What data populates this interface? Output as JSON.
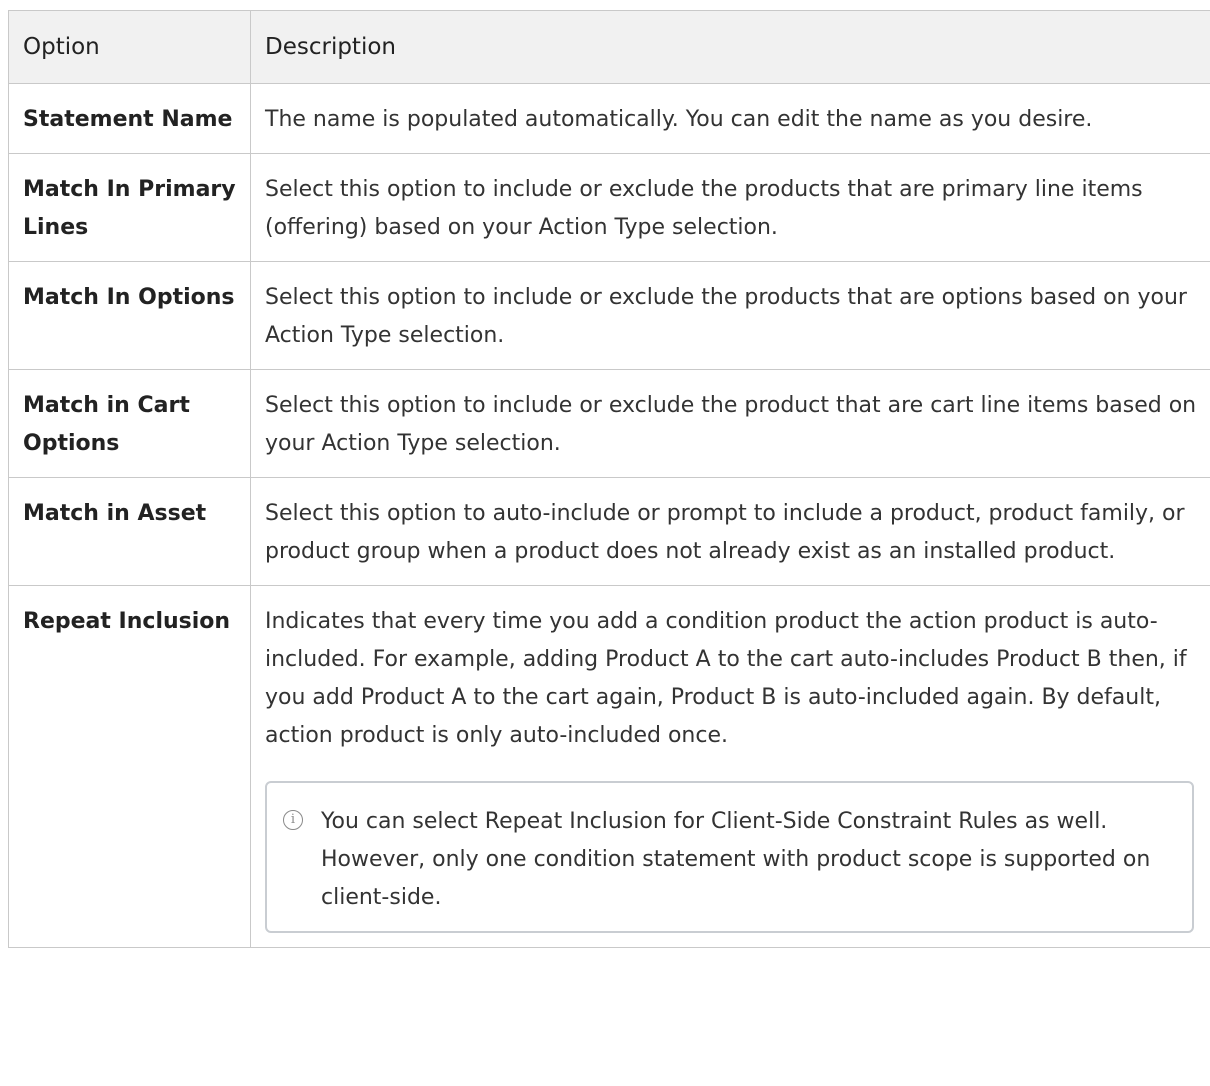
{
  "table": {
    "headers": {
      "option": "Option",
      "description": "Description"
    },
    "rows": [
      {
        "option": "Statement Name",
        "description": "The name is populated automatically. You can edit the name as you desire."
      },
      {
        "option": "Match In Primary Lines",
        "description": "Select this option to include or exclude the products that are primary line items (offering) based on your Action Type selection."
      },
      {
        "option": "Match In Options",
        "description": "Select this option to include or exclude the products that are options based on your Action Type selection."
      },
      {
        "option": "Match in Cart Options",
        "description": "Select this option to include or exclude the product that are cart line items based on your Action Type selection."
      },
      {
        "option": "Match in Asset",
        "description": "Select this option to auto-include or prompt to include a product, product family, or product group when a product does not already exist as an installed product."
      },
      {
        "option": "Repeat Inclusion",
        "description": "Indicates that every time you add a condition product the action product is auto-included. For example, adding Product A to the cart auto-includes Product B then, if you add Product A to the cart again, Product B is auto-included again. By default, action product is only auto-included once."
      }
    ],
    "note": {
      "icon": "info-icon",
      "text": "You can select Repeat Inclusion for Client-Side Constraint Rules as well. However, only one condition statement with product scope is supported on client-side."
    }
  }
}
